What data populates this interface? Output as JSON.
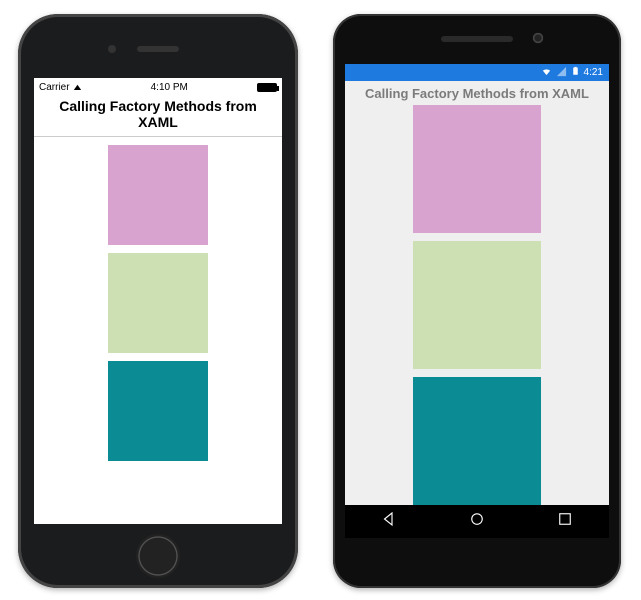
{
  "ios": {
    "status": {
      "carrier": "Carrier",
      "wifi": "wifi-icon",
      "time": "4:10 PM"
    },
    "title": "Calling Factory Methods from XAML",
    "colors": [
      "#d9a3cf",
      "#cde0b4",
      "#0b8b93"
    ]
  },
  "android": {
    "status": {
      "time": "4:21",
      "icons": [
        "wifi-icon",
        "signal-icon",
        "battery-icon"
      ]
    },
    "title": "Calling Factory Methods from XAML",
    "colors": [
      "#d9a3cf",
      "#cde0b4",
      "#0b8b93"
    ],
    "nav": [
      "back",
      "home",
      "recent"
    ]
  }
}
